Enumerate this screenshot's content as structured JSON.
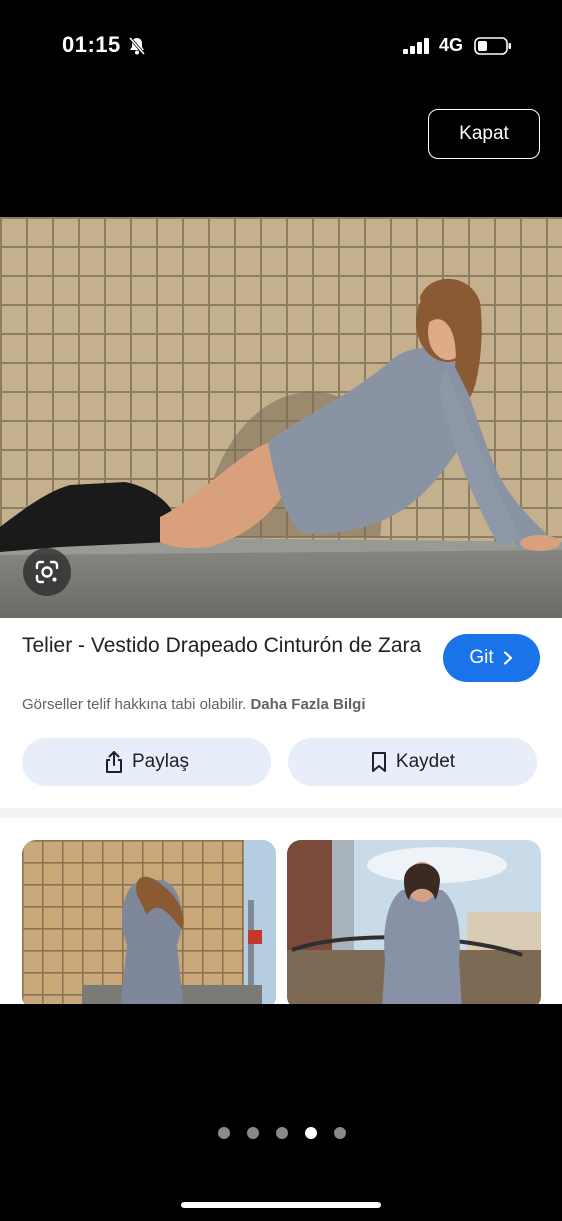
{
  "status": {
    "time": "01:15",
    "network": "4G",
    "icons": [
      "bell-slash-icon",
      "signal-icon",
      "battery-icon"
    ]
  },
  "close_label": "Kapat",
  "result": {
    "title": "Telier - Vestido Drapeado Cinturón de Zara",
    "go_label": "Git",
    "copyright_text": "Görseller telif hakkına tabi olabilir.",
    "more_info": "Daha Fazla Bilgi",
    "share_label": "Paylaş",
    "save_label": "Kaydet"
  },
  "pagination": {
    "total": 5,
    "active_index": 3
  },
  "colors": {
    "go_button": "#1a73e8",
    "action_button_bg": "#e8eef9",
    "background": "#000000"
  }
}
